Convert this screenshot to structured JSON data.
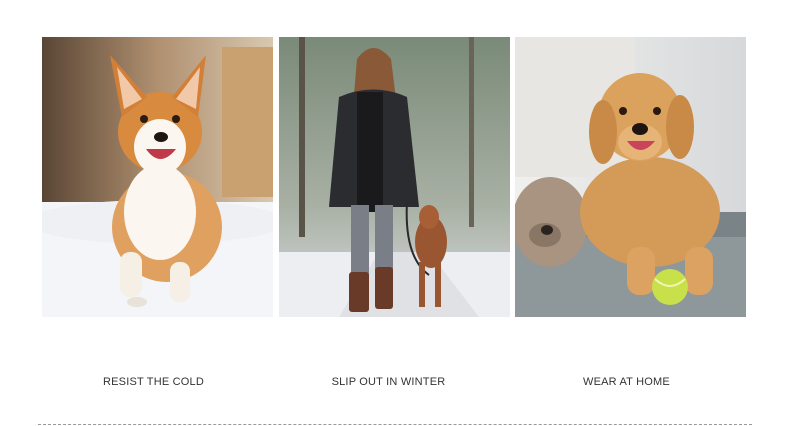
{
  "captions": [
    "RESIST THE COLD",
    "SLIP OUT IN WINTER",
    "WEAR AT HOME"
  ]
}
